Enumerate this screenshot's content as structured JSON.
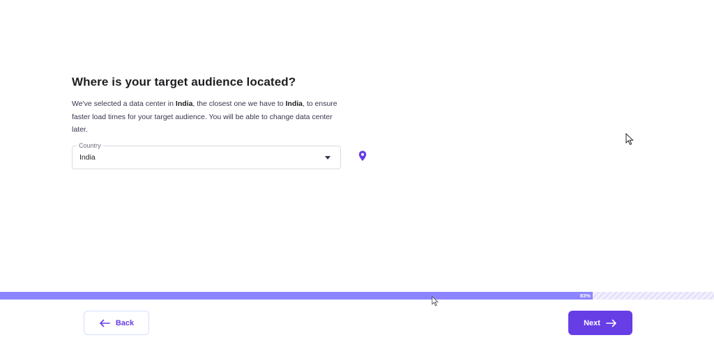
{
  "question": {
    "title": "Where is your target audience located?",
    "desc_part1": "We've selected a data center in ",
    "desc_country1": "India",
    "desc_part2": ", the closest one we have to ",
    "desc_country2": "India",
    "desc_part3": ", to ensure faster load times for your target audience. You will be able to change data center later."
  },
  "country_select": {
    "label": "Country",
    "value": "India"
  },
  "icons": {
    "location": "map-pin-icon",
    "dropdown": "chevron-down-icon",
    "back": "arrow-left-icon",
    "next": "arrow-right-icon"
  },
  "progress": {
    "percent": 83,
    "label": "83%"
  },
  "footer": {
    "back_label": "Back",
    "next_label": "Next"
  },
  "colors": {
    "primary": "#673de6",
    "progress_fill": "#8c85ff",
    "text_dark": "#1d1e20"
  }
}
